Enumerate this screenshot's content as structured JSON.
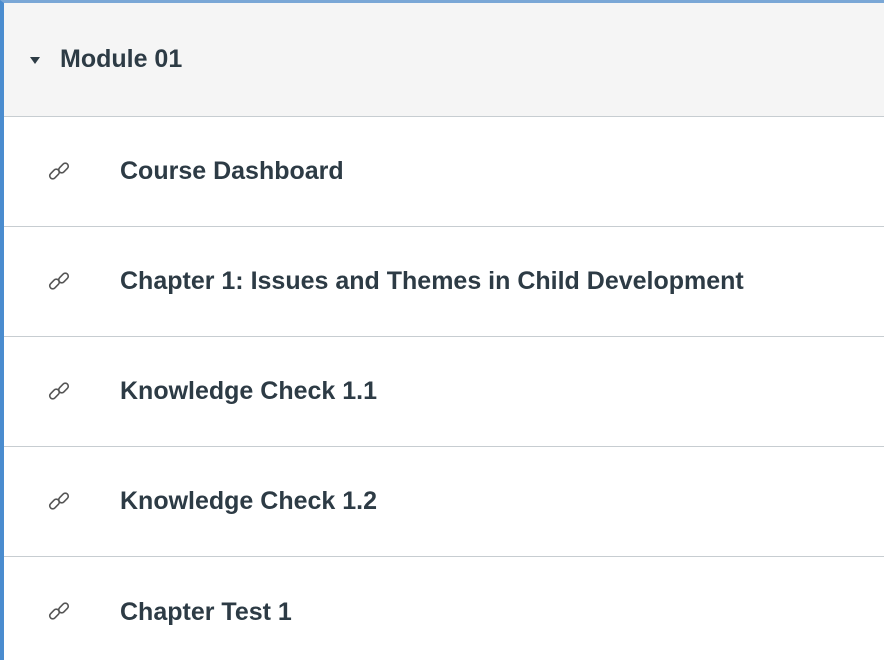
{
  "module": {
    "title": "Module 01",
    "items": [
      {
        "label": "Course Dashboard",
        "icon": "link-icon"
      },
      {
        "label": "Chapter 1: Issues and Themes in Child Development",
        "icon": "link-icon"
      },
      {
        "label": "Knowledge Check 1.1",
        "icon": "link-icon"
      },
      {
        "label": "Knowledge Check 1.2",
        "icon": "link-icon"
      },
      {
        "label": "Chapter Test 1",
        "icon": "link-icon"
      }
    ]
  },
  "colors": {
    "accent_border": "#4a8ccf",
    "text": "#2d3b45",
    "header_bg": "#f5f5f5",
    "divider": "#c7cdd1"
  }
}
